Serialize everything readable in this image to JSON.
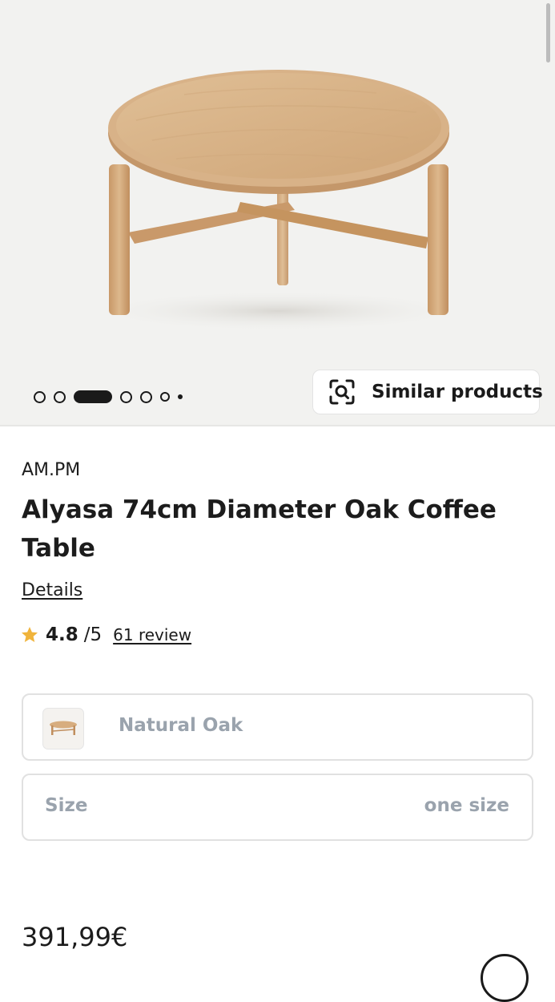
{
  "gallery": {
    "image_alt": "Round oak coffee table with four legs",
    "dots_total": 7,
    "active_dot_index": 2,
    "similar_products_label": "Similar products",
    "similar_icon": "visual-search-icon"
  },
  "product": {
    "brand": "AM.PM",
    "title": "Alyasa 74cm Diameter Oak Coffee Table",
    "details_label": "Details",
    "rating": {
      "value": "4.8",
      "max": "/5",
      "reviews_label": "61 review",
      "star_color": "#f0b43c"
    },
    "color_option": {
      "label": "Natural Oak",
      "swatch_icon": "coffee-table-thumbnail"
    },
    "size_option": {
      "label": "Size",
      "value": "one size"
    },
    "price": "391,99€"
  },
  "colors": {
    "text": "#1c1c1c",
    "muted": "#9aa3ad",
    "gallery_bg": "#f2f2f0",
    "oak": "#d9b48a"
  }
}
